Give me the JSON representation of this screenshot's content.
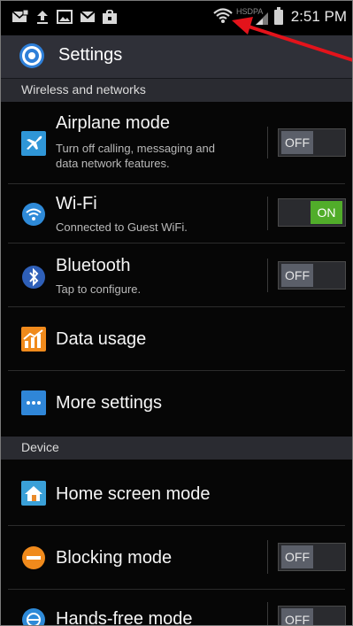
{
  "status_bar": {
    "time": "2:51 PM",
    "icons": [
      "messages-icon",
      "upload-icon",
      "gallery-icon",
      "gmail-icon",
      "shopping-bag-icon",
      "wifi-icon",
      "signal-icon",
      "battery-icon"
    ],
    "network_label": "HSDPA"
  },
  "action_bar": {
    "title": "Settings",
    "icon": "gear-icon"
  },
  "sections": {
    "wireless": "Wireless and networks",
    "device": "Device"
  },
  "items": {
    "airplane": {
      "title": "Airplane mode",
      "subtitle_line1": "Turn off calling, messaging and",
      "subtitle_line2": "data network features.",
      "toggle": "OFF"
    },
    "wifi": {
      "title": "Wi-Fi",
      "subtitle": "Connected to Guest WiFi.",
      "toggle": "ON"
    },
    "bluetooth": {
      "title": "Bluetooth",
      "subtitle": "Tap to configure.",
      "toggle": "OFF"
    },
    "data_usage": {
      "title": "Data usage"
    },
    "more_settings": {
      "title": "More settings"
    },
    "home_screen": {
      "title": "Home screen mode"
    },
    "blocking": {
      "title": "Blocking mode",
      "toggle": "OFF"
    },
    "hands_free": {
      "title": "Hands-free mode",
      "toggle": "OFF"
    }
  },
  "colors": {
    "toggle_on": "#51ad2a",
    "toggle_off": "#5b5f69",
    "section_bg": "#2a2b31",
    "annotation_arrow": "#e3131b"
  }
}
